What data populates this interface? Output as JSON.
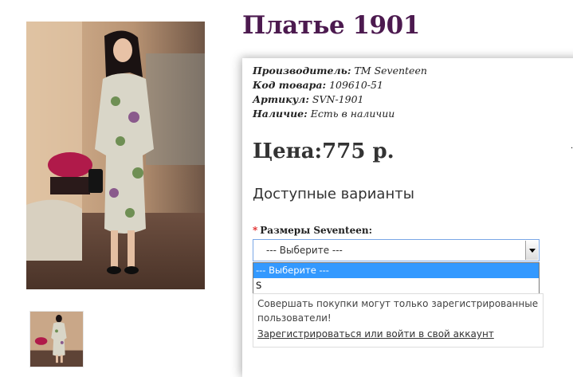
{
  "product": {
    "title": "Платье 1901",
    "meta": [
      {
        "key": "Производитель:",
        "value": "ТМ Seventeen"
      },
      {
        "key": "Код товара:",
        "value": "109610-51"
      },
      {
        "key": "Артикул:",
        "value": "SVN-1901"
      },
      {
        "key": "Наличие:",
        "value": "Есть в наличии"
      }
    ],
    "price": "Цена:775 р."
  },
  "variants": {
    "heading": "Доступные варианты",
    "required_mark": "*",
    "size_label": "Размеры Seventeen:",
    "select": {
      "value": "--- Выберите ---",
      "options": [
        "--- Выберите ---",
        "S"
      ]
    }
  },
  "notice": {
    "text": "Совершать покупки могут только зарегистрированные пользователи!",
    "link": "Зарегистрироваться или войти в свой аккаунт"
  },
  "colors": {
    "title": "#4c1a4f",
    "option_highlight": "#3399ff"
  },
  "icons": {
    "select_arrow": "chevron-down-icon"
  }
}
